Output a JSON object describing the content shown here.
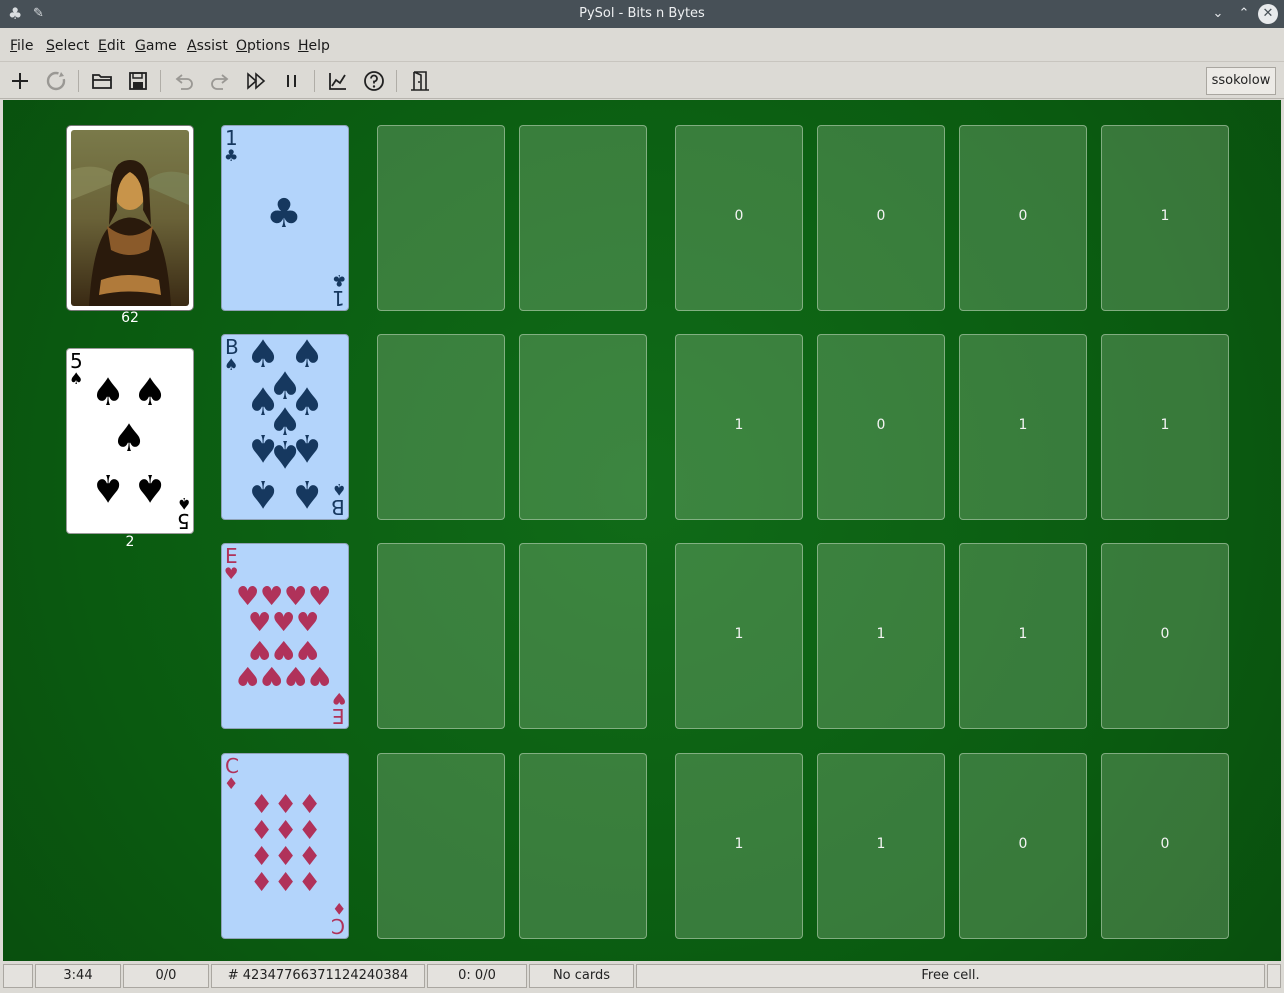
{
  "window": {
    "title": "PySol - Bits n Bytes",
    "app_icon": "clubs-icon",
    "pin_icon": "pin-icon",
    "controls": [
      "chevron-down-icon",
      "chevron-up-icon",
      "close-icon"
    ]
  },
  "menu": {
    "items": [
      {
        "label": "File"
      },
      {
        "label": "Select"
      },
      {
        "label": "Edit"
      },
      {
        "label": "Game"
      },
      {
        "label": "Assist"
      },
      {
        "label": "Options"
      },
      {
        "label": "Help"
      }
    ]
  },
  "toolbar": {
    "buttons": [
      {
        "icon": "new-game-icon"
      },
      {
        "icon": "restart-icon"
      },
      {
        "icon": "open-folder-icon"
      },
      {
        "icon": "save-icon"
      },
      {
        "icon": "undo-icon"
      },
      {
        "icon": "redo-icon"
      },
      {
        "icon": "autodrop-icon"
      },
      {
        "icon": "pause-icon"
      },
      {
        "icon": "statistics-icon"
      },
      {
        "icon": "help-icon"
      },
      {
        "icon": "quit-icon"
      }
    ],
    "player": "ssokolow"
  },
  "game": {
    "stock": {
      "count": "62",
      "back": "mona-lisa"
    },
    "waste": {
      "count": "2",
      "card": {
        "rank": "5",
        "suit": "♠",
        "color": "black"
      }
    },
    "rows": [
      {
        "card": {
          "rank": "1",
          "suit": "♣",
          "color": "blue"
        },
        "free_cells": 2,
        "foundations": [
          "0",
          "0",
          "0",
          "1"
        ]
      },
      {
        "card": {
          "rank": "B",
          "suit": "♠",
          "color": "blue"
        },
        "free_cells": 2,
        "foundations": [
          "1",
          "0",
          "1",
          "1"
        ]
      },
      {
        "card": {
          "rank": "E",
          "suit": "♥",
          "color": "red"
        },
        "free_cells": 2,
        "foundations": [
          "1",
          "1",
          "1",
          "0"
        ]
      },
      {
        "card": {
          "rank": "C",
          "suit": "♦",
          "color": "red"
        },
        "free_cells": 2,
        "foundations": [
          "1",
          "1",
          "0",
          "0"
        ]
      }
    ]
  },
  "status": {
    "time": "3:44",
    "moves": "0/0",
    "game_number": "# 42347766371124240384",
    "score": "0: 0/0",
    "cards_info": "No cards",
    "message": "Free cell."
  },
  "colors": {
    "felt": "#0b5f12",
    "card_face": "#b3d4fb",
    "blue_ink": "#16385f",
    "red_ink": "#b0325a"
  }
}
